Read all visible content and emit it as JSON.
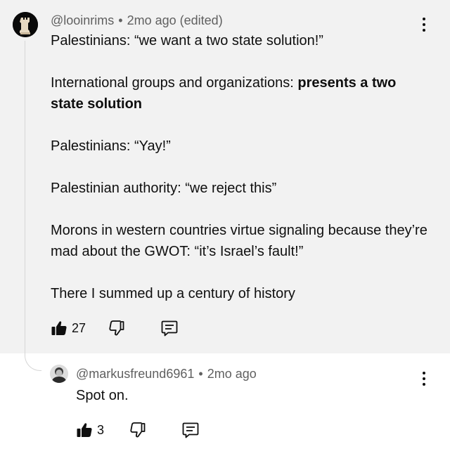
{
  "comment": {
    "author": "@looinrims",
    "separator": "•",
    "time": "2mo ago (edited)",
    "lines": {
      "p1": "Palestinians: “we want a two state solution!”",
      "p2_normal": "International groups and organizations: ",
      "p2_bold": "presents a two state solution",
      "p3": "Palestinians: “Yay!”",
      "p4": "Palestinian authority: “we reject this”",
      "p5": "Morons in western countries virtue signaling because they’re mad about the GWOT: “it’s Israel’s fault!”",
      "p6": "There I summed up a century of history"
    },
    "likes": "27",
    "icons": {
      "avatar": "avatar",
      "like": "thumbs-up-icon",
      "dislike": "thumbs-down-icon",
      "reply": "reply-icon",
      "more": "more-vert-icon"
    }
  },
  "reply": {
    "author": "@markusfreund6961",
    "separator": "•",
    "time": "2mo ago",
    "text": "Spot on.",
    "likes": "3"
  },
  "colors": {
    "highlight_bg": "#f2f2f2",
    "meta_text": "#606060",
    "text": "#0f0f0f",
    "thread_line": "#d6d6d6"
  }
}
